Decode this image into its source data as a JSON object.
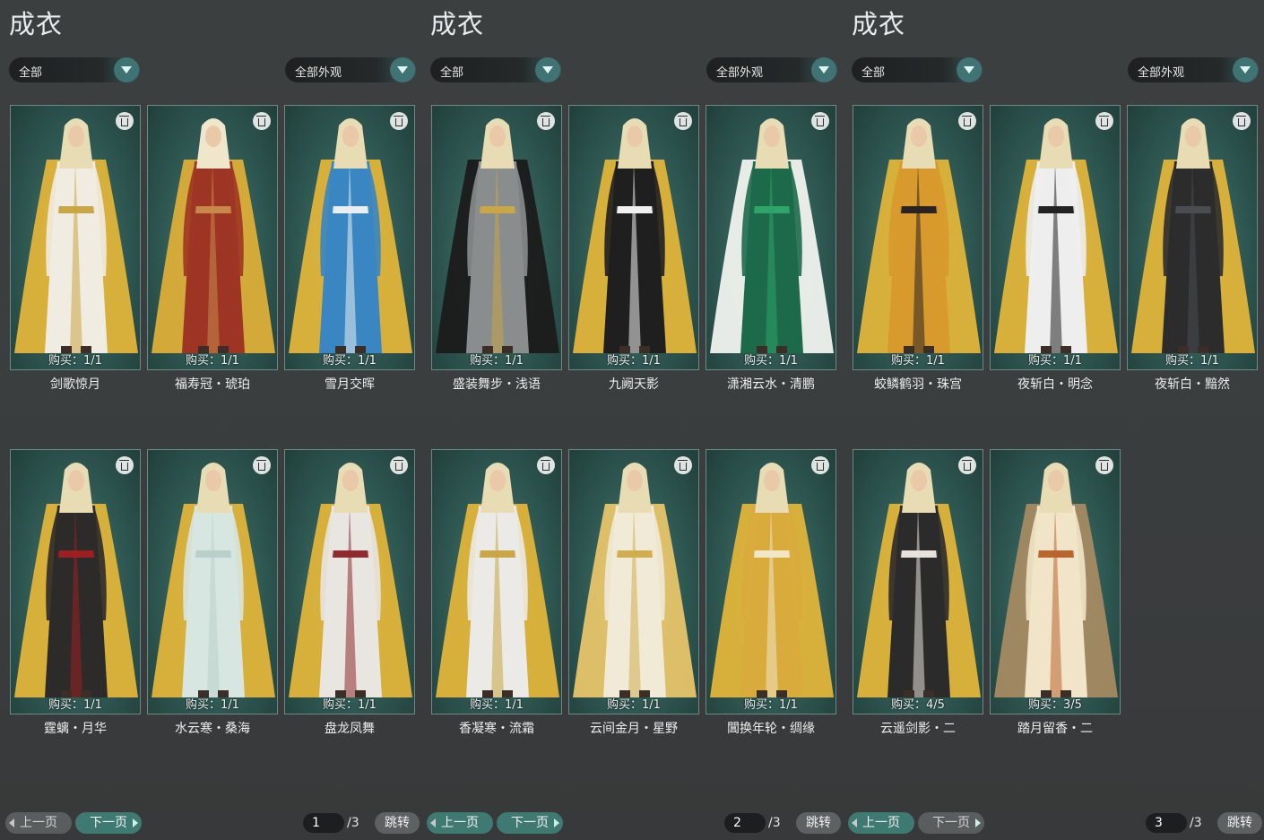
{
  "panels": [
    {
      "title": "成衣",
      "filter1": "全部",
      "filter2": "全部外观",
      "items": [
        {
          "buy": "购买：1/1",
          "name": "剑歌惊月",
          "style": {
            "hair": "#e8dcb4",
            "cape": "#e0b43a",
            "robe": "#f1ece1",
            "accent": "#c9a646"
          }
        },
        {
          "buy": "购买：1/1",
          "name": "福寿冠・琥珀",
          "style": {
            "hair": "#f0e6cc",
            "cape": "#dcae38",
            "robe": "#9e3524",
            "accent": "#c9884a"
          }
        },
        {
          "buy": "购买：1/1",
          "name": "雪月交晖",
          "style": {
            "hair": "#e8dcb4",
            "cape": "#e0b43a",
            "robe": "#3a86c2",
            "accent": "#e8eef2"
          }
        },
        {
          "buy": "购买：1/1",
          "name": "霆螭・月华",
          "style": {
            "hair": "#e8dcb4",
            "cape": "#e0b43a",
            "robe": "#2d2a2a",
            "accent": "#9c1f22"
          }
        },
        {
          "buy": "购买：1/1",
          "name": "水云寒・桑海",
          "style": {
            "hair": "#e8dcb4",
            "cape": "#e0b43a",
            "robe": "#d8e6e2",
            "accent": "#b9cfc9"
          }
        },
        {
          "buy": "购买：1/1",
          "name": "盘龙凤舞",
          "style": {
            "hair": "#e8dcb4",
            "cape": "#e0b43a",
            "robe": "#e9e6e2",
            "accent": "#8f2a2e"
          }
        }
      ],
      "prev": "上一页",
      "next": "下一页",
      "prev_enabled": false,
      "next_enabled": true,
      "page": "1",
      "total": "/3",
      "jump": "跳转"
    },
    {
      "title": "成衣",
      "filter1": "全部",
      "filter2": "全部外观",
      "items": [
        {
          "buy": "购买：1/1",
          "name": "盛装舞步・浅语",
          "style": {
            "hair": "#e8dcb4",
            "cape": "#1b1b1b",
            "robe": "#8a8d8e",
            "accent": "#c9a646"
          }
        },
        {
          "buy": "购买：1/1",
          "name": "九阙天影",
          "style": {
            "hair": "#e8dcb4",
            "cape": "#e0b43a",
            "robe": "#1f1f20",
            "accent": "#f1f1f1"
          }
        },
        {
          "buy": "购买：1/1",
          "name": "潇湘云水・清鹏",
          "style": {
            "hair": "#e8dcb4",
            "cape": "#f1f3ef",
            "robe": "#1d6a4b",
            "accent": "#2ea36a"
          }
        },
        {
          "buy": "购买：1/1",
          "name": "香凝寒・流霜",
          "style": {
            "hair": "#e8dcb4",
            "cape": "#e0b43a",
            "robe": "#eceae6",
            "accent": "#c9a646"
          }
        },
        {
          "buy": "购买：1/1",
          "name": "云间金月・星野",
          "style": {
            "hair": "#e8dcb4",
            "cape": "#e7c46a",
            "robe": "#f0ead7",
            "accent": "#d2ad4f"
          }
        },
        {
          "buy": "购买：1/1",
          "name": "閶换年轮・绸缘",
          "style": {
            "hair": "#e8dcb4",
            "cape": "#e0b43a",
            "robe": "#d9ab3d",
            "accent": "#f1e6c6"
          }
        }
      ],
      "prev": "上一页",
      "next": "下一页",
      "prev_enabled": true,
      "next_enabled": true,
      "page": "2",
      "total": "/3",
      "jump": "跳转"
    },
    {
      "title": "成衣",
      "filter1": "全部",
      "filter2": "全部外观",
      "items": [
        {
          "buy": "购买：1/1",
          "name": "蛟鳞鹤羽・珠宫",
          "style": {
            "hair": "#e8dcb4",
            "cape": "#e0b43a",
            "robe": "#d89a2c",
            "accent": "#2a2322"
          }
        },
        {
          "buy": "购买：1/1",
          "name": "夜斩白・明念",
          "style": {
            "hair": "#e8dcb4",
            "cape": "#e0b43a",
            "robe": "#eeeeee",
            "accent": "#222222"
          }
        },
        {
          "buy": "购买：1/1",
          "name": "夜斩白・黯然",
          "style": {
            "hair": "#e8dcb4",
            "cape": "#e0b43a",
            "robe": "#2c2c2d",
            "accent": "#4a4d50"
          }
        },
        {
          "buy": "购买：4/5",
          "name": "云遥剑影・二",
          "style": {
            "hair": "#e8dcb4",
            "cape": "#e0b43a",
            "robe": "#2b2b2b",
            "accent": "#e6e3dc"
          }
        },
        {
          "buy": "购买：3/5",
          "name": "踏月留香・二",
          "style": {
            "hair": "#e8dcb4",
            "cape": "#a48a62",
            "robe": "#f1e4c8",
            "accent": "#b9652e"
          }
        }
      ],
      "prev": "上一页",
      "next": "下一页",
      "prev_enabled": true,
      "next_enabled": false,
      "page": "3",
      "total": "/3",
      "jump": "跳转"
    }
  ]
}
